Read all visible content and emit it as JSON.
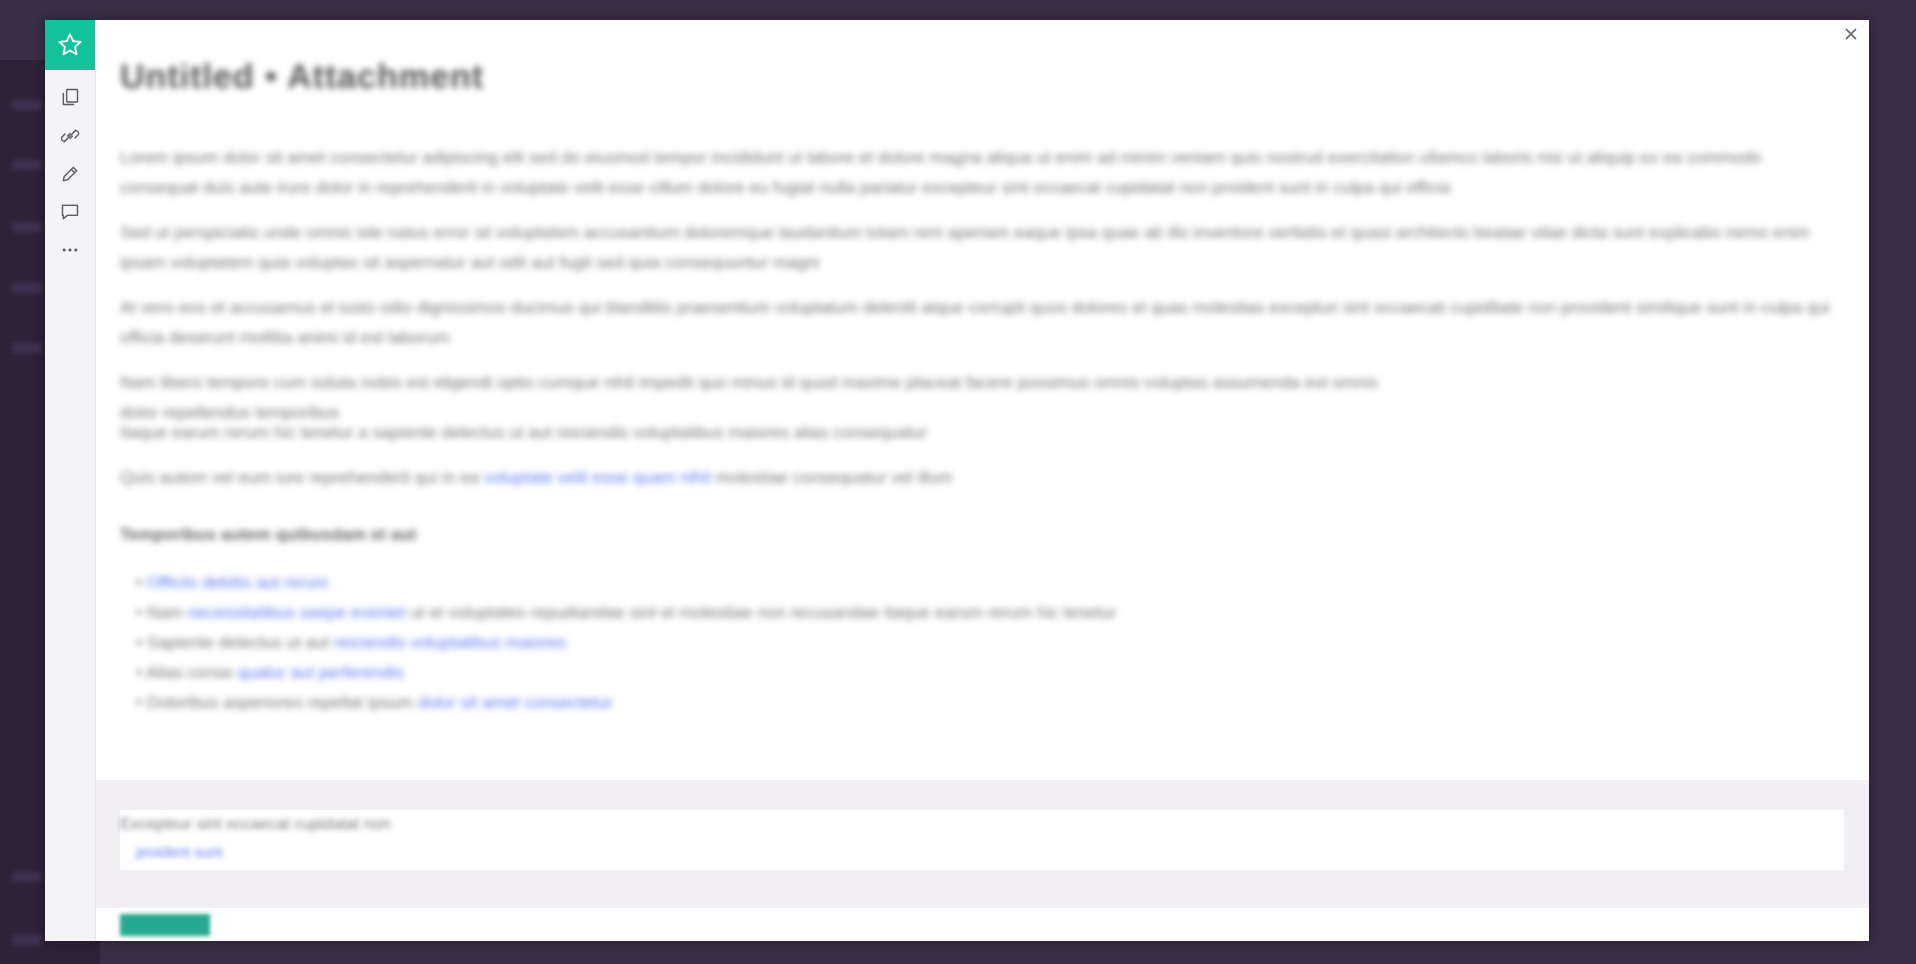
{
  "modal": {
    "title": "Untitled • Attachment",
    "paragraphs": [
      "Lorem ipsum dolor sit amet consectetur adipiscing elit sed do eiusmod tempor incididunt ut labore et dolore magna aliqua ut enim ad minim veniam quis nostrud exercitation ullamco laboris nisi ut aliquip ex ea commodo consequat duis aute irure dolor in reprehenderit in voluptate velit esse cillum dolore eu fugiat nulla pariatur excepteur sint occaecat cupidatat non proident sunt in culpa qui officia",
      "Sed ut perspiciatis unde omnis iste natus error sit voluptatem accusantium doloremque laudantium totam rem aperiam eaque ipsa quae ab illo inventore veritatis et quasi architecto beatae vitae dicta sunt explicabo nemo enim ipsam voluptatem quia voluptas sit aspernatur aut odit aut fugit sed quia consequuntur magni",
      "At vero eos et accusamus et iusto odio dignissimos ducimus qui blanditiis praesentium voluptatum deleniti atque corrupti quos dolores et quas molestias excepturi sint occaecati cupiditate non provident similique sunt in culpa qui officia deserunt mollitia animi id est laborum",
      "Nam libero tempore cum soluta nobis est eligendi optio cumque nihil impedit quo minus id quod maxime placeat facere possimus omnis voluptas assumenda est omnis dolor repellendus temporibus",
      "Itaque earum rerum hic tenetur a sapiente delectus ut aut reiciendis voluptatibus maiores alias consequatur",
      "Quis autem vel eum iure reprehenderit qui in ea"
    ],
    "inline_link": "voluptate velit esse quam nihil",
    "inline_suffix": "molestiae consequatur vel illum",
    "subheading": "Temporibus autem quibusdam et aut",
    "list": [
      {
        "pre": "• ",
        "link": "Officiis debitis aut rerum",
        "post": ""
      },
      {
        "pre": "• Nam ",
        "link": "necessitatibus saepe eveniet",
        "post": " ut et voluptates repudiandae sint et molestiae non recusandae itaque earum rerum hic tenetur"
      },
      {
        "pre": "• Sapiente delectus ut aut ",
        "link": "reiciendis voluptatibus maiores",
        "post": ""
      },
      {
        "pre": "• Alias conse ",
        "link": "quatur aut perferendis",
        "post": ""
      },
      {
        "pre": "• Doloribus asperiores repellat ipsum ",
        "link": "dolor sit amet consectetur",
        "post": ""
      }
    ]
  },
  "footer": {
    "card_text": "Excepteur sint occaecat cupidatat non",
    "card_link": "proident sunt"
  },
  "colors": {
    "brand": "#12c29a",
    "link": "#5b7cf2",
    "button": "#25a891"
  }
}
